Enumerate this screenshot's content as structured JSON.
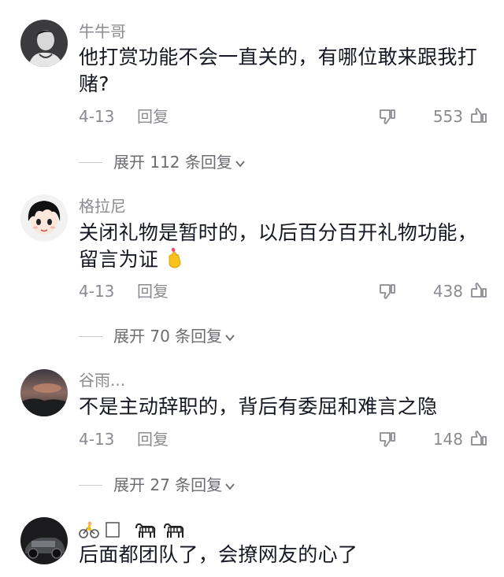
{
  "comments": [
    {
      "username": "牛牛哥",
      "text": "他打赏功能不会一直关的，有哪位敢来跟我打赌?",
      "date": "4-13",
      "reply_label": "回复",
      "likes": "553",
      "expand_label": "展开 112 条回复"
    },
    {
      "username": "格拉尼",
      "text": "关闭礼物是暂时的，以后百分百开礼物功能，留言为证",
      "date": "4-13",
      "reply_label": "回复",
      "likes": "438",
      "expand_label": "展开 70 条回复"
    },
    {
      "username": "谷雨...",
      "text": "不是主动辞职的，背后有委屈和难言之隐",
      "date": "4-13",
      "reply_label": "回复",
      "likes": "148",
      "expand_label": "展开 27 条回复"
    },
    {
      "username": "",
      "text": "后面都团队了，会撩网友的心了"
    }
  ],
  "colors": {
    "text_primary": "#161823",
    "text_secondary": "#8a8b91",
    "divider": "#c9c9cd"
  }
}
